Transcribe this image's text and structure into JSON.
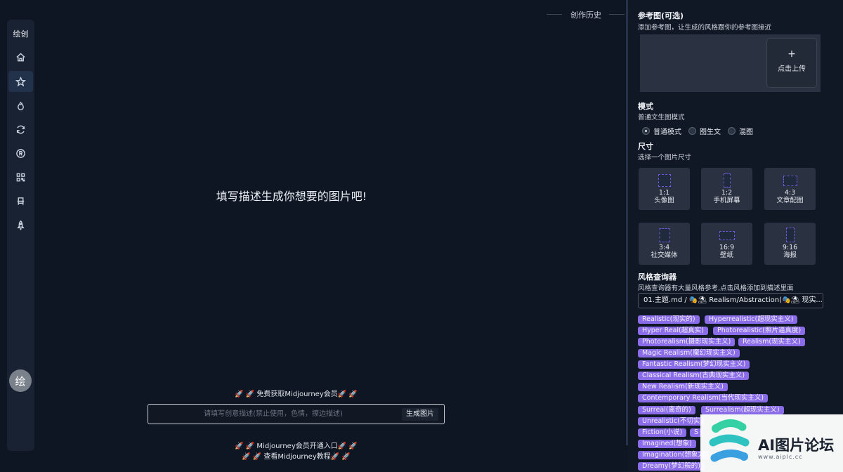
{
  "sidebar": {
    "brand": "绘创",
    "nav": [
      {
        "icon": "home-icon"
      },
      {
        "icon": "star-icon",
        "active": true
      },
      {
        "icon": "flame-icon"
      },
      {
        "icon": "refresh-icon"
      },
      {
        "icon": "registered-icon"
      },
      {
        "icon": "qr-code-icon"
      },
      {
        "icon": "chair-icon"
      },
      {
        "icon": "rocket-icon"
      }
    ],
    "avatar": "绘"
  },
  "main": {
    "history_title": "创作历史",
    "empty_message": "填写描述生成你想要的图片吧!",
    "promo_free": "🚀 🚀 免费获取Midjourney会员🚀 🚀",
    "prompt_placeholder": "请填写创意描述(禁止使用，色情，擦边描述)",
    "generate_button": "生成图片",
    "promo_member": "🚀 🚀 Midjourney会员开通入口🚀 🚀",
    "promo_tutorial": "🚀 🚀 查看Midjourney教程🚀 🚀"
  },
  "panel": {
    "reference": {
      "title": "参考图(可选)",
      "subtitle": "添加参考图，让生成的风格跟你的参考图接近",
      "upload_plus": "+",
      "upload_label": "点击上传"
    },
    "mode": {
      "title": "模式",
      "subtitle": "普通文生图模式",
      "options": [
        "普通模式",
        "图生文",
        "混图"
      ],
      "selected_index": 0
    },
    "size": {
      "title": "尺寸",
      "subtitle": "选择一个图片尺寸",
      "options": [
        {
          "ratio": "1:1",
          "name": "头像图"
        },
        {
          "ratio": "1:2",
          "name": "手机屏幕"
        },
        {
          "ratio": "4:3",
          "name": "文章配图"
        },
        {
          "ratio": "3:4",
          "name": "社交媒体"
        },
        {
          "ratio": "16:9",
          "name": "壁纸"
        },
        {
          "ratio": "9:16",
          "name": "海报"
        }
      ]
    },
    "style": {
      "title": "风格查询器",
      "subtitle": "风格查询器有大量风格参考,点击风格添加到描述里面",
      "selected": "01.主题.md / 🎭⛱ Realism/Abstraction(🎭⛱ 现实...",
      "tags": [
        "Realistic(现实的)",
        "Hyperrealistic(超现实主义)",
        "Hyper Real(超真实)",
        "Photorealistic(照片逼真度)",
        "Photorealism(摄影现实主义)",
        "Realism(现实主义)",
        "Magic Realism(魔幻现实主义)",
        "Fantastic Realism(梦幻现实主义)",
        "Classical Realism(古典现实主义)",
        "New Realism(新现实主义)",
        "Contemporary Realism(当代现实主义)",
        "Surreal(离奇的)",
        "Surrealism(超现实主义)",
        "Unrealistic(不切实",
        "Fiction(小说)",
        "S",
        "Imagined(想象)",
        "Imagination(想象力",
        "Dreamy(梦幻般的)"
      ]
    }
  },
  "watermark": {
    "text": "AI图片论坛",
    "url": "www.aiplc.cc"
  },
  "colors": {
    "accent": "#8a6be8",
    "background": "#0f1623",
    "panel": "#101826"
  }
}
